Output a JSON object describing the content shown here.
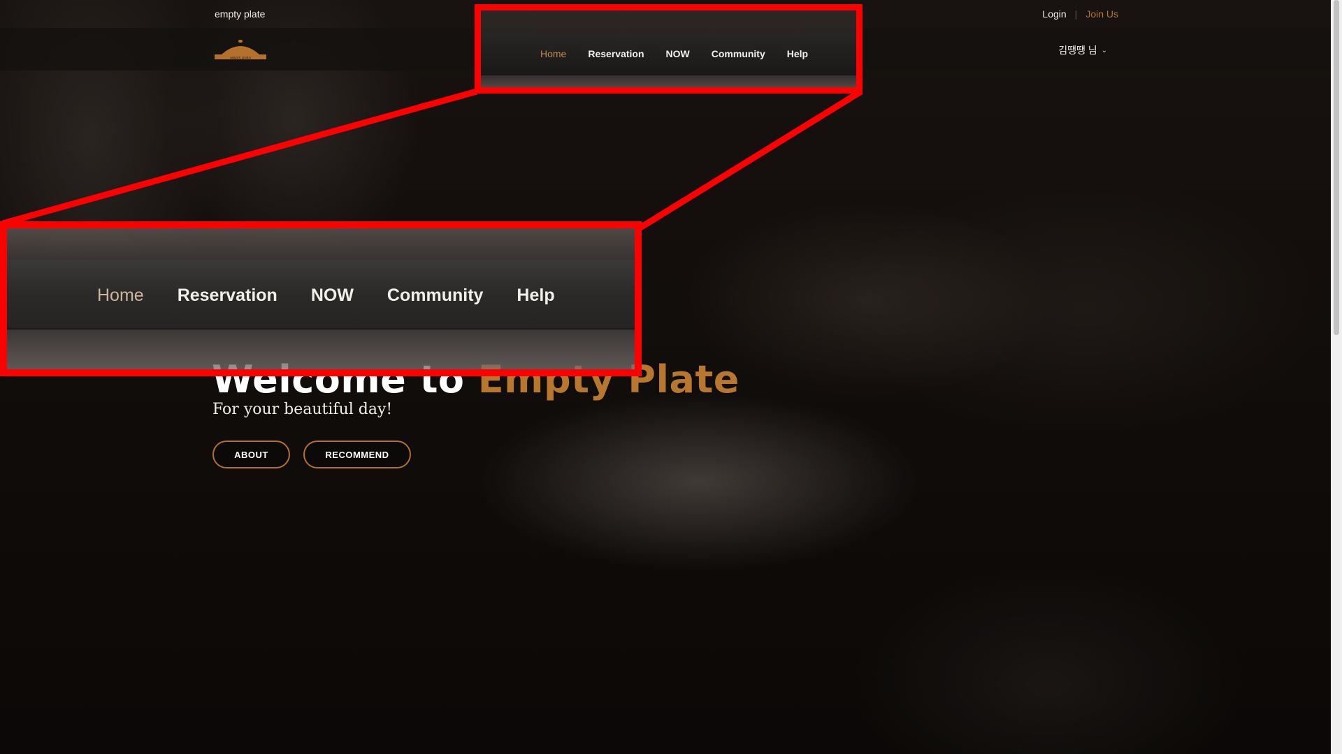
{
  "header": {
    "brand": "empty plate",
    "login": "Login",
    "separator": "|",
    "join": "Join Us"
  },
  "logo": {
    "text": "empty plate"
  },
  "nav": {
    "items": [
      {
        "label": "Home",
        "active": true
      },
      {
        "label": "Reservation"
      },
      {
        "label": "NOW"
      },
      {
        "label": "Community"
      },
      {
        "label": "Help"
      }
    ],
    "user": "김땡땡 님"
  },
  "hero": {
    "title_main": "Welcome to ",
    "title_accent": "Empty Plate",
    "subtitle": "For your beautiful day!",
    "about_button": "ABOUT",
    "recommend_button": "RECOMMEND"
  },
  "colors": {
    "accent": "#b7772f",
    "highlight": "#ff0000",
    "active_nav": "#c08a50"
  }
}
